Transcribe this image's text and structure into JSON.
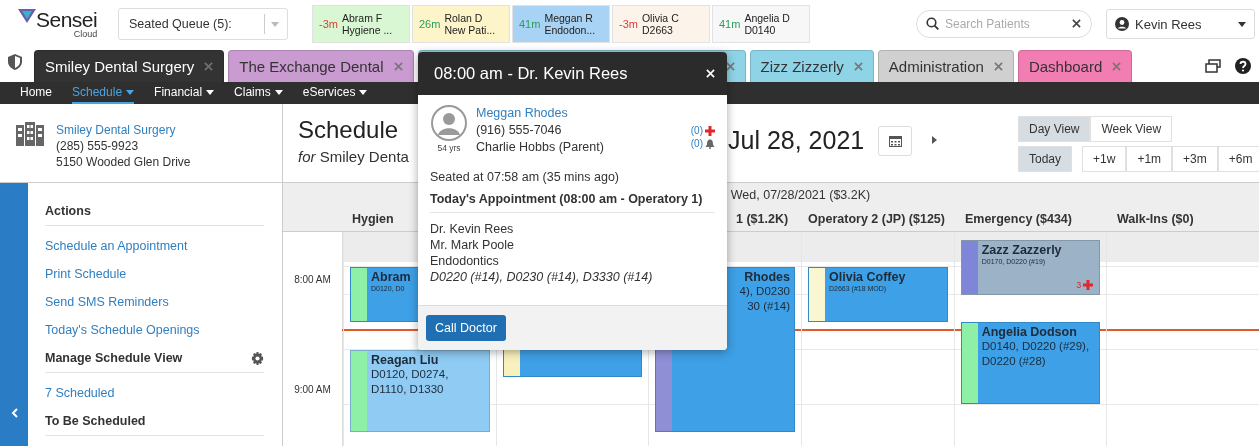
{
  "logo": {
    "name": "Sensei",
    "sub": "Cloud"
  },
  "seated_queue": {
    "label": "Seated Queue (5):"
  },
  "queue": [
    {
      "wait": "-3m",
      "overdue": true,
      "name": "Abram F",
      "detail": "Hygiene ...",
      "color": "#d8f7d2"
    },
    {
      "wait": "26m",
      "overdue": false,
      "name": "Rolan D",
      "detail": "New Pati...",
      "color": "#fdf5c9"
    },
    {
      "wait": "41m",
      "overdue": false,
      "name": "Meggan R",
      "detail": "Endodon...",
      "color": "#a8d3f4"
    },
    {
      "wait": "-3m",
      "overdue": true,
      "name": "Olivia C",
      "detail": "D2663",
      "color": "#fcf4ea"
    },
    {
      "wait": "41m",
      "overdue": false,
      "name": "Angelia D",
      "detail": "D0140",
      "color": "#f7f7f7"
    }
  ],
  "search": {
    "placeholder": "Search Patients"
  },
  "user": {
    "name": "Kevin Rees"
  },
  "tabs": [
    {
      "label": "Smiley Dental Surgery",
      "selected": true,
      "color": "#333333"
    },
    {
      "label": "The Exchange Dental",
      "selected": false,
      "color": "#c99bd0"
    },
    {
      "selected": false,
      "color": "#8fd4e6"
    },
    {
      "label": "Zizz Zizzerly",
      "selected": false,
      "color": "#8fd4e6"
    },
    {
      "label": "Administration",
      "selected": false,
      "color": "#d0d0d0"
    },
    {
      "label": "Dashboard",
      "selected": false,
      "color": "#f27db3"
    }
  ],
  "nav": [
    {
      "label": "Home",
      "menu": false,
      "selected": false
    },
    {
      "label": "Schedule",
      "menu": true,
      "selected": true
    },
    {
      "label": "Financial",
      "menu": true,
      "selected": false
    },
    {
      "label": "Claims",
      "menu": true,
      "selected": false
    },
    {
      "label": "eServices",
      "menu": true,
      "selected": false
    }
  ],
  "practice": {
    "name": "Smiley Dental Surgery",
    "phone": "(285) 555-9923",
    "address": "5150 Wooded Glen Drive"
  },
  "sidebar": [
    {
      "kind": "header",
      "label": "Actions"
    },
    {
      "kind": "link",
      "label": "Schedule an Appointment"
    },
    {
      "kind": "link",
      "label": "Print Schedule"
    },
    {
      "kind": "link",
      "label": "Send SMS Reminders"
    },
    {
      "kind": "link",
      "label": "Today's Schedule Openings"
    },
    {
      "kind": "settings",
      "label": "Manage Schedule View"
    },
    {
      "kind": "link",
      "label": "7 Scheduled"
    },
    {
      "kind": "header",
      "label": "To Be Scheduled"
    }
  ],
  "schedule": {
    "title": "Schedule",
    "subtitle": "*for* Smiley Denta",
    "date": "Jul 28, 2021",
    "views": [
      {
        "label": "Day View",
        "selected": true
      },
      {
        "label": "Week View",
        "selected": false
      }
    ],
    "today": "Today",
    "jumps": [
      "+1w",
      "+1m",
      "+3m",
      "+6m"
    ],
    "day_header": "Wed, 07/28/2021 ($3.2K)",
    "time_labels": [
      "8:00 AM",
      "9:00 AM"
    ],
    "columns": [
      {
        "label": "Hygien",
        "appointments": [
          {
            "name": "Abram",
            "codes": [
              "D0120, D0"
            ],
            "color": "#8ef0a6",
            "kind": "active"
          },
          {
            "name": "Reagan Liu",
            "codes": [
              "D0120, D0274,",
              "D1110, D1330"
            ],
            "color": "#8ef0a6",
            "kind": "light"
          }
        ]
      },
      {
        "appointments": [
          {
            "color": "#f9f1bd",
            "kind": "active"
          }
        ]
      },
      {
        "label": "1 ($1.2K)",
        "appointments": [
          {
            "name": "Rhodes",
            "codes": [
              "4), D0230",
              "30 (#14)"
            ],
            "color": "#8f8fd6",
            "kind": "active"
          }
        ]
      },
      {
        "label": "Operatory 2 (JP) ($125)",
        "appointments": [
          {
            "name": "Olivia Coffey",
            "codes": [
              "D2663 (#18 MOD)"
            ],
            "color": "#fbf6d2",
            "kind": "active"
          }
        ]
      },
      {
        "label": "Emergency ($434)",
        "appointments": [
          {
            "name": "Zazz Zazzerly",
            "codes": [
              "D0170, D0220 (#19)"
            ],
            "color": "#7f86d8",
            "kind": "muted",
            "alerts": "3"
          },
          {
            "name": "Angelia Dodson",
            "codes": [
              "D0140, D0220 (#29),",
              "D0220 (#28)"
            ],
            "color": "#8ef0a6",
            "kind": "active"
          }
        ]
      },
      {
        "label": "Walk-Ins ($0)"
      }
    ]
  },
  "popup": {
    "title": "08:00 am - Dr. Kevin Rees",
    "patient": {
      "name": "Meggan Rhodes",
      "phone": "(916) 555-7046",
      "age": "54 yrs",
      "guardian": "Charlie Hobbs (Parent)",
      "medical_alerts": "(0)",
      "reminders": "(0)"
    },
    "seated": "Seated at 07:58 am (35 mins ago)",
    "appointment_title": "Today's Appointment (08:00 am - Operatory 1)",
    "details": [
      "Dr. Kevin Rees",
      "Mr. Mark Poole",
      "Endodontics"
    ],
    "procedures": "D0220 (#14), D0230 (#14), D3330 (#14)",
    "action": "Call Doctor"
  }
}
